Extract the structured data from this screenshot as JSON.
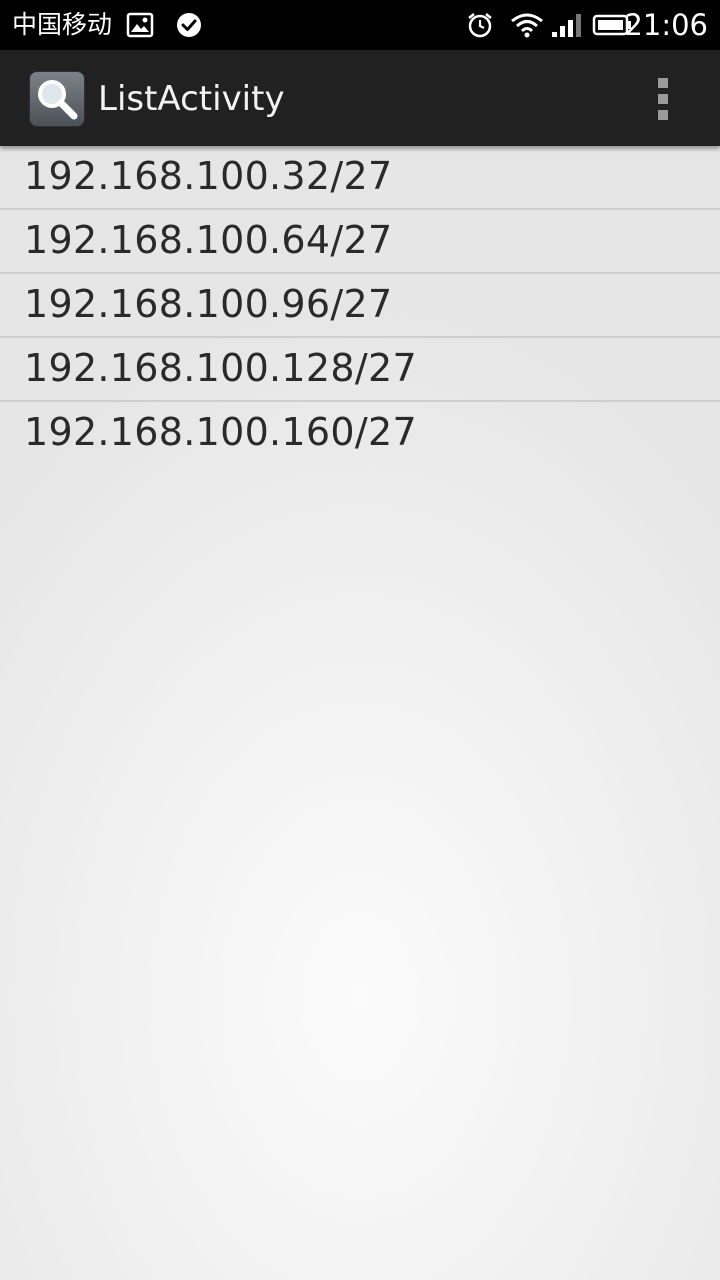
{
  "status_bar": {
    "carrier": "中国移动",
    "time": "21:06",
    "icons": [
      "image-notification-icon",
      "check-circle-icon",
      "alarm-clock-icon",
      "wifi-icon",
      "signal-icon",
      "battery-icon"
    ]
  },
  "action_bar": {
    "title": "ListActivity",
    "app_icon": "search-icon",
    "menu_icon": "overflow-menu-icon"
  },
  "list": {
    "items": [
      {
        "label": "192.168.100.32/27"
      },
      {
        "label": "192.168.100.64/27"
      },
      {
        "label": "192.168.100.96/27"
      },
      {
        "label": "192.168.100.128/27"
      },
      {
        "label": "192.168.100.160/27"
      }
    ]
  },
  "colors": {
    "status_bar_bg": "#000000",
    "action_bar_bg": "#212121",
    "list_text": "#2a2a2a",
    "divider": "#cfcfcf"
  }
}
